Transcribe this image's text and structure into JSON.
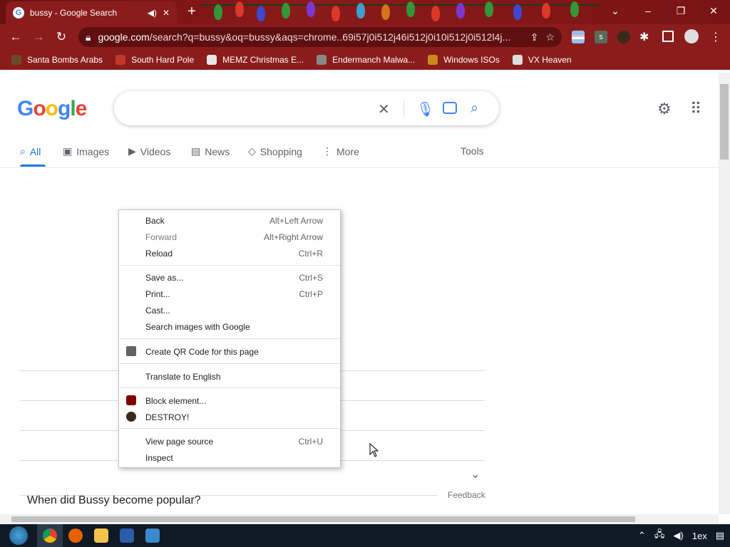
{
  "window": {
    "tab_title": "bussy - Google Search",
    "controls": {
      "minimize": "–",
      "restore": "❐",
      "close": "✕",
      "tabsearch": "⌄"
    }
  },
  "toolbar": {
    "url_domain": "google.com",
    "url_path": "/search?q=bussy&oq=bussy&aqs=chrome..69i57j0i512j46i512j0i10i512j0i512l4j..."
  },
  "bookmarks": [
    {
      "label": "Santa Bombs Arabs",
      "color": "#6b4a2a"
    },
    {
      "label": "South Hard Pole",
      "color": "#c0392b"
    },
    {
      "label": "MEMZ Christmas E...",
      "color": "#e7e7e7"
    },
    {
      "label": "Endermanch Malwa...",
      "color": "#888888"
    },
    {
      "label": "Windows ISOs",
      "color": "#c98a1a"
    },
    {
      "label": "VX Heaven",
      "color": "#dddddd"
    }
  ],
  "logo": {
    "letters": [
      "G",
      "o",
      "o",
      "g",
      "l",
      "e"
    ],
    "colors": [
      "#4285f4",
      "#ea4335",
      "#fbbc05",
      "#4285f4",
      "#34a853",
      "#ea4335"
    ]
  },
  "nav": {
    "tabs": [
      {
        "label": "All",
        "icon": "search-icon",
        "glyph": "⌕"
      },
      {
        "label": "Images",
        "icon": "image-icon",
        "glyph": "▣"
      },
      {
        "label": "Videos",
        "icon": "video-icon",
        "glyph": "▶"
      },
      {
        "label": "News",
        "icon": "news-icon",
        "glyph": "▤"
      },
      {
        "label": "Shopping",
        "icon": "tag-icon",
        "glyph": "◇"
      },
      {
        "label": "More",
        "icon": "more-vert-icon",
        "glyph": "⋮"
      }
    ],
    "tools": "Tools"
  },
  "context_menu": {
    "back": {
      "label": "Back",
      "shortcut": "Alt+Left Arrow"
    },
    "forward": {
      "label": "Forward",
      "shortcut": "Alt+Right Arrow"
    },
    "reload": {
      "label": "Reload",
      "shortcut": "Ctrl+R"
    },
    "save": {
      "label": "Save as...",
      "shortcut": "Ctrl+S"
    },
    "print": {
      "label": "Print...",
      "shortcut": "Ctrl+P"
    },
    "cast": {
      "label": "Cast..."
    },
    "search_images": {
      "label": "Search images with Google"
    },
    "qr": {
      "label": "Create QR Code for this page"
    },
    "translate": {
      "label": "Translate to English"
    },
    "block": {
      "label": "Block element..."
    },
    "destroy": {
      "label": "DESTROY!"
    },
    "source": {
      "label": "View page source",
      "shortcut": "Ctrl+U"
    },
    "inspect": {
      "label": "Inspect"
    }
  },
  "results": {
    "faq_question": "When did Bussy become popular?",
    "feedback": "Feedback"
  },
  "tray": {
    "language": "1ex"
  }
}
